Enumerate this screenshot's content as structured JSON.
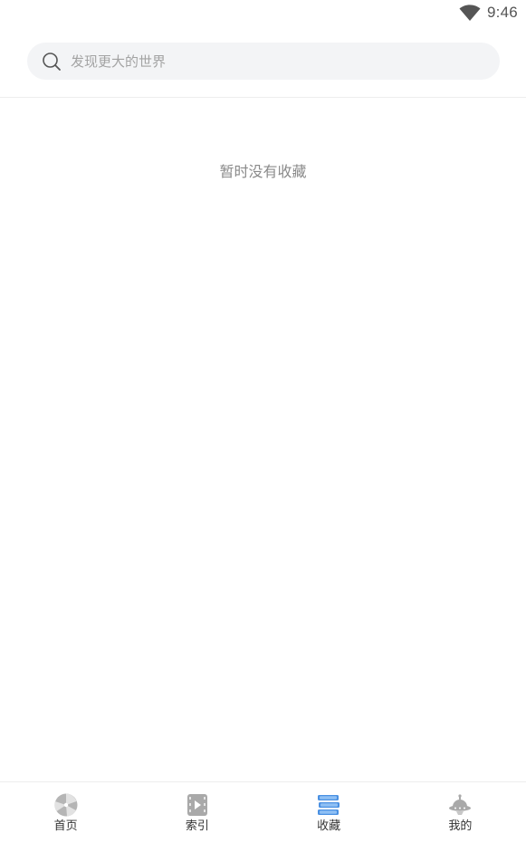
{
  "status_bar": {
    "time": "9:46",
    "icons": [
      "wifi-icon"
    ]
  },
  "search": {
    "placeholder": "发现更大的世界",
    "value": "",
    "icon": "search-icon"
  },
  "empty_state": {
    "message": "暂时没有收藏"
  },
  "bottom_nav": {
    "active_index": 2,
    "colors": {
      "inactive_icon": "#a9a9a9",
      "active_icon": "#4a90e2"
    },
    "items": [
      {
        "label": "首页",
        "icon": "pinwheel-icon"
      },
      {
        "label": "索引",
        "icon": "film-icon"
      },
      {
        "label": "收藏",
        "icon": "stack-icon"
      },
      {
        "label": "我的",
        "icon": "alien-icon"
      }
    ]
  }
}
